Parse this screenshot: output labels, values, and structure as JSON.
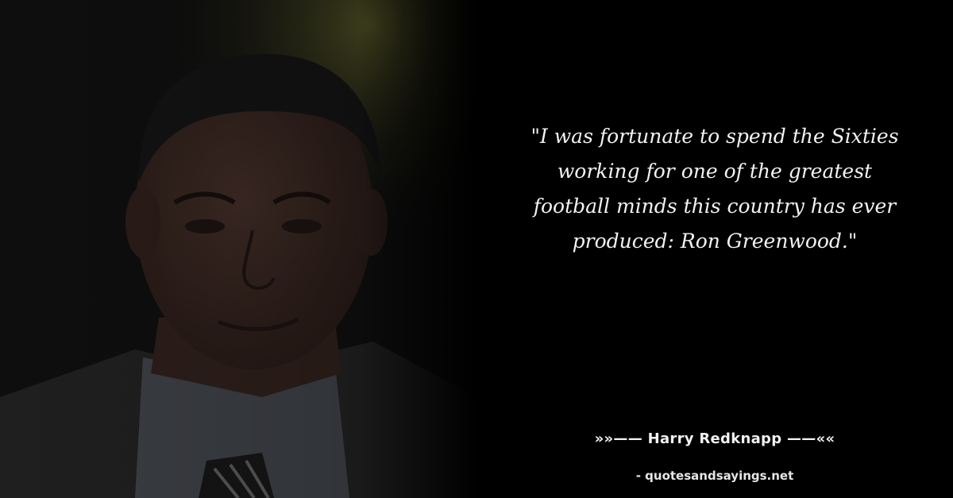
{
  "quote": {
    "text": "\"I was fortunate to spend the Sixties working for one of the greatest football minds this country has ever produced: Ron Greenwood.\""
  },
  "author": {
    "line": "»»—— Harry Redknapp ——««"
  },
  "source": {
    "line": "- quotesandsayings.net"
  },
  "colors": {
    "background": "#000000",
    "text": "#f2f2f2"
  }
}
